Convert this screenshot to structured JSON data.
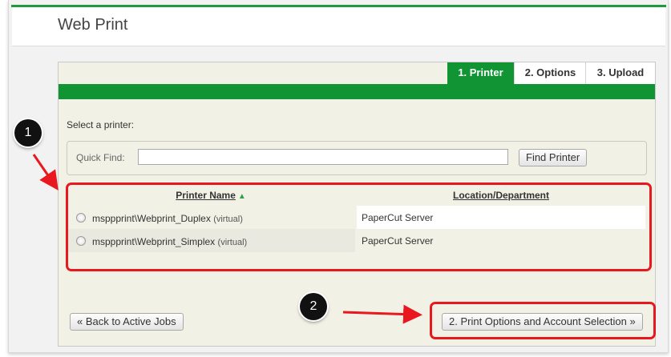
{
  "header": {
    "title": "Web Print"
  },
  "tabs": [
    {
      "label": "1. Printer",
      "active": true
    },
    {
      "label": "2. Options",
      "active": false
    },
    {
      "label": "3. Upload",
      "active": false
    }
  ],
  "main": {
    "select_label": "Select a printer:",
    "quick_find": {
      "label": "Quick Find:",
      "value": "",
      "placeholder": "",
      "button": "Find Printer"
    },
    "table": {
      "columns": [
        "Printer Name",
        "Location/Department"
      ],
      "sort_indicator": "▲",
      "rows": [
        {
          "name_base": "msppprint\\Webprint_Duplex",
          "name_suffix": "(virtual)",
          "location": "PaperCut Server"
        },
        {
          "name_base": "msppprint\\Webprint_Simplex",
          "name_suffix": "(virtual)",
          "location": "PaperCut Server"
        }
      ]
    },
    "back_button": "« Back to Active Jobs",
    "next_button": "2. Print Options and Account Selection »"
  },
  "annotations": {
    "badge1": "1",
    "badge2": "2"
  },
  "colors": {
    "accent": "#119434",
    "panel_bg": "#f1f1e6",
    "annotation": "#e8181e"
  }
}
